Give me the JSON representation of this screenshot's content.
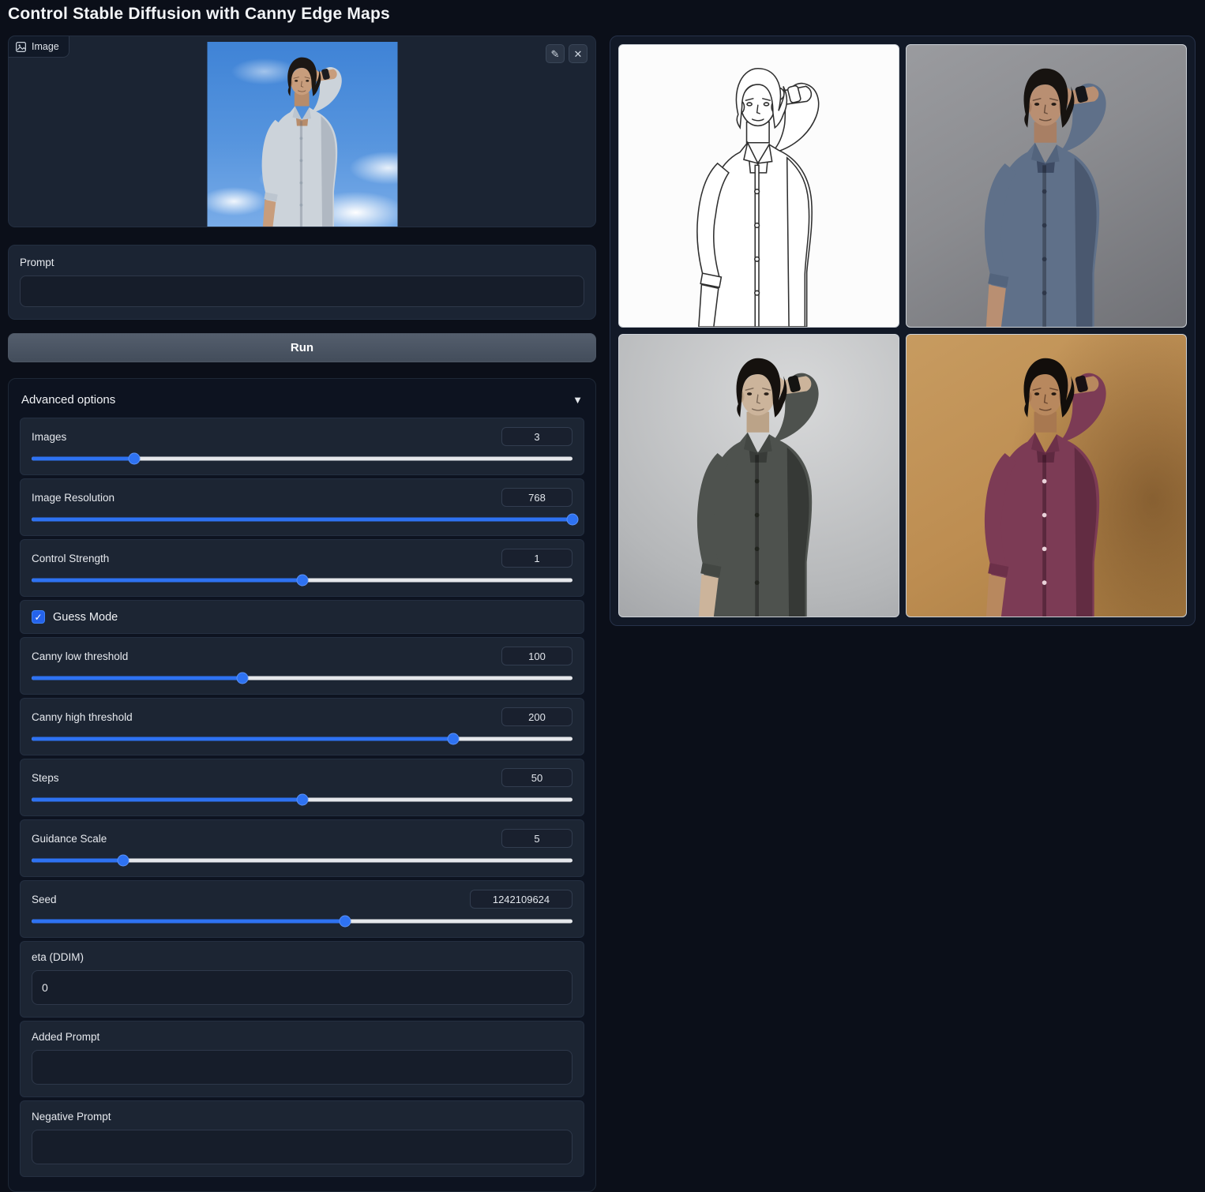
{
  "title": "Control Stable Diffusion with Canny Edge Maps",
  "input_image": {
    "label": "Image",
    "edit_glyph": "✎",
    "clear_glyph": "✕",
    "content_desc": "photo of a man with dark hair in a light blue shirt, hand behind his head, blue sky with clouds"
  },
  "prompt": {
    "label": "Prompt",
    "value": ""
  },
  "run_label": "Run",
  "advanced": {
    "header": "Advanced options",
    "collapse_glyph": "▼",
    "sliders": [
      {
        "label": "Images",
        "value": "3",
        "percent": 19
      },
      {
        "label": "Image Resolution",
        "value": "768",
        "percent": 100
      },
      {
        "label": "Control Strength",
        "value": "1",
        "percent": 50
      },
      {
        "label": "Canny low threshold",
        "value": "100",
        "percent": 39
      },
      {
        "label": "Canny high threshold",
        "value": "200",
        "percent": 78
      },
      {
        "label": "Steps",
        "value": "50",
        "percent": 50
      },
      {
        "label": "Guidance Scale",
        "value": "5",
        "percent": 17
      },
      {
        "label": "Seed",
        "value": "1242109624",
        "percent": 58
      }
    ],
    "checkbox": {
      "label": "Guess Mode",
      "checked": true,
      "check_glyph": "✓"
    },
    "textboxes": [
      {
        "label": "eta (DDIM)",
        "value": "0"
      },
      {
        "label": "Added Prompt",
        "value": ""
      },
      {
        "label": "Negative Prompt",
        "value": ""
      }
    ]
  },
  "gallery": {
    "items": [
      {
        "name": "canny-edge-map",
        "desc": "black and white canny edge line drawing of the man"
      },
      {
        "name": "generated-slate-blue",
        "desc": "generated image: man in slate blue shirt on gray background"
      },
      {
        "name": "generated-charcoal",
        "desc": "generated image: man in dark charcoal shirt on light gray background"
      },
      {
        "name": "generated-burgundy",
        "desc": "generated image: man in burgundy shirt on tan background"
      }
    ]
  },
  "colors": {
    "accent": "#2e72f2",
    "page_bg": "#0b0f19",
    "panel_bg": "#1b2433",
    "run_bg": "#4b5563"
  }
}
